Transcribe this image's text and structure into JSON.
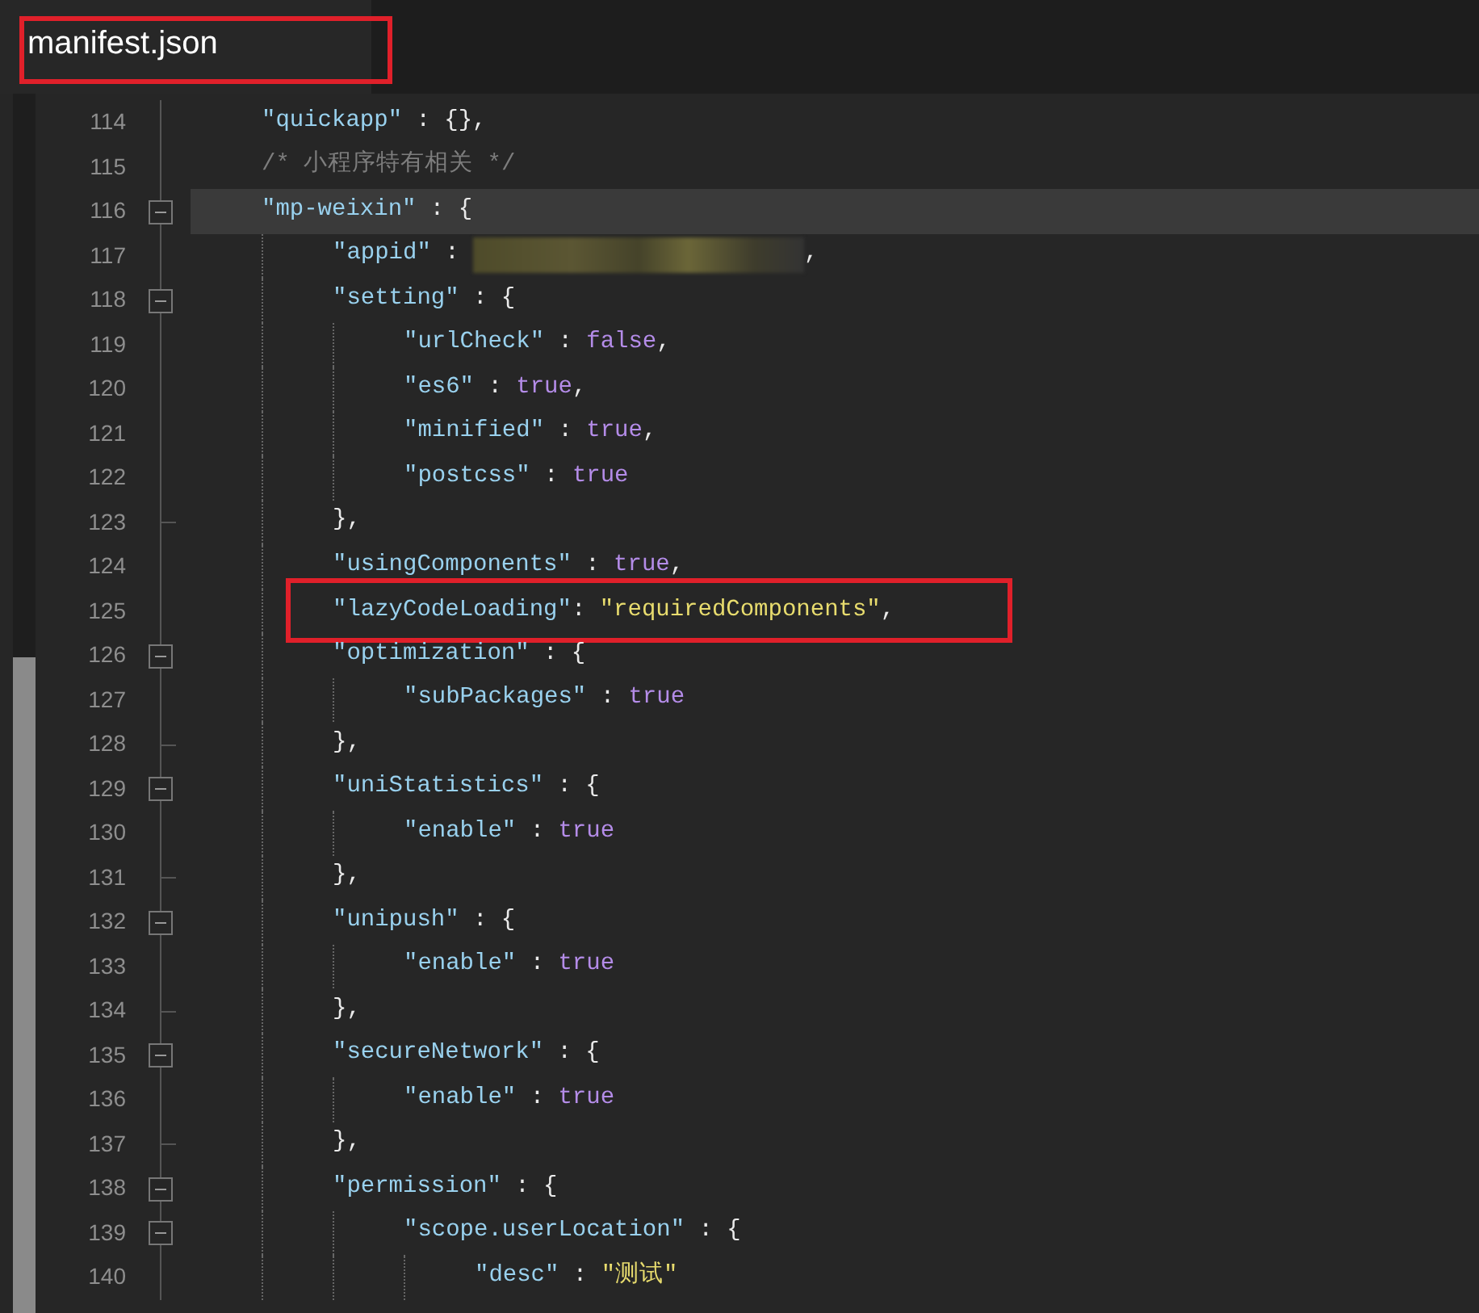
{
  "tab": {
    "title": "manifest.json",
    "highlighted": true
  },
  "lines": [
    {
      "number": "114",
      "fold_toggle": false,
      "fold_end": false,
      "current": false,
      "highlighted": false,
      "tokens": [
        {
          "t": "\"quickapp\"",
          "kind": "key"
        },
        {
          "t": " : {},",
          "kind": "punct"
        }
      ]
    },
    {
      "number": "115",
      "fold_toggle": false,
      "fold_end": false,
      "current": false,
      "highlighted": false,
      "tokens": [
        {
          "t": "/* 小程序特有相关 */",
          "kind": "comment"
        }
      ]
    },
    {
      "number": "116",
      "fold_toggle": true,
      "fold_end": false,
      "current": true,
      "highlighted": false,
      "tokens": [
        {
          "t": "\"mp-weixin\"",
          "kind": "key"
        },
        {
          "t": " : {",
          "kind": "punct"
        }
      ],
      "children": [
        {
          "number": "117",
          "fold_toggle": false,
          "fold_end": false,
          "current": false,
          "highlighted": false,
          "tokens": [
            {
              "t": "\"appid\"",
              "kind": "key"
            },
            {
              "t": " : ",
              "kind": "punct"
            },
            {
              "kind": "redacted"
            },
            {
              "t": ",",
              "kind": "punct"
            }
          ]
        },
        {
          "number": "118",
          "fold_toggle": true,
          "fold_end": false,
          "current": false,
          "highlighted": false,
          "tokens": [
            {
              "t": "\"setting\"",
              "kind": "key"
            },
            {
              "t": " : {",
              "kind": "punct"
            }
          ],
          "children": [
            {
              "number": "119",
              "fold_toggle": false,
              "fold_end": false,
              "current": false,
              "highlighted": false,
              "tokens": [
                {
                  "t": "\"urlCheck\"",
                  "kind": "key"
                },
                {
                  "t": " : ",
                  "kind": "punct"
                },
                {
                  "t": "false",
                  "kind": "bool"
                },
                {
                  "t": ",",
                  "kind": "punct"
                }
              ]
            },
            {
              "number": "120",
              "fold_toggle": false,
              "fold_end": false,
              "current": false,
              "highlighted": false,
              "tokens": [
                {
                  "t": "\"es6\"",
                  "kind": "key"
                },
                {
                  "t": " : ",
                  "kind": "punct"
                },
                {
                  "t": "true",
                  "kind": "bool"
                },
                {
                  "t": ",",
                  "kind": "punct"
                }
              ]
            },
            {
              "number": "121",
              "fold_toggle": false,
              "fold_end": false,
              "current": false,
              "highlighted": false,
              "tokens": [
                {
                  "t": "\"minified\"",
                  "kind": "key"
                },
                {
                  "t": " : ",
                  "kind": "punct"
                },
                {
                  "t": "true",
                  "kind": "bool"
                },
                {
                  "t": ",",
                  "kind": "punct"
                }
              ]
            },
            {
              "number": "122",
              "fold_toggle": false,
              "fold_end": false,
              "current": false,
              "highlighted": false,
              "tokens": [
                {
                  "t": "\"postcss\"",
                  "kind": "key"
                },
                {
                  "t": " : ",
                  "kind": "punct"
                },
                {
                  "t": "true",
                  "kind": "bool"
                }
              ]
            }
          ]
        },
        {
          "number": "123",
          "fold_toggle": false,
          "fold_end": true,
          "current": false,
          "highlighted": false,
          "tokens": [
            {
              "t": "},",
              "kind": "punct"
            }
          ]
        },
        {
          "number": "124",
          "fold_toggle": false,
          "fold_end": false,
          "current": false,
          "highlighted": false,
          "tokens": [
            {
              "t": "\"usingComponents\"",
              "kind": "key"
            },
            {
              "t": " : ",
              "kind": "punct"
            },
            {
              "t": "true",
              "kind": "bool"
            },
            {
              "t": ",",
              "kind": "punct"
            }
          ]
        },
        {
          "number": "125",
          "fold_toggle": false,
          "fold_end": false,
          "current": false,
          "highlighted": true,
          "tokens": [
            {
              "t": "\"lazyCodeLoading\"",
              "kind": "key"
            },
            {
              "t": ": ",
              "kind": "punct"
            },
            {
              "t": "\"requiredComponents\"",
              "kind": "string"
            },
            {
              "t": ",",
              "kind": "punct"
            }
          ]
        },
        {
          "number": "126",
          "fold_toggle": true,
          "fold_end": false,
          "current": false,
          "highlighted": false,
          "tokens": [
            {
              "t": "\"optimization\"",
              "kind": "key"
            },
            {
              "t": " : {",
              "kind": "punct"
            }
          ],
          "children": [
            {
              "number": "127",
              "fold_toggle": false,
              "fold_end": false,
              "current": false,
              "highlighted": false,
              "tokens": [
                {
                  "t": "\"subPackages\"",
                  "kind": "key"
                },
                {
                  "t": " : ",
                  "kind": "punct"
                },
                {
                  "t": "true",
                  "kind": "bool"
                }
              ]
            }
          ]
        },
        {
          "number": "128",
          "fold_toggle": false,
          "fold_end": true,
          "current": false,
          "highlighted": false,
          "tokens": [
            {
              "t": "},",
              "kind": "punct"
            }
          ]
        },
        {
          "number": "129",
          "fold_toggle": true,
          "fold_end": false,
          "current": false,
          "highlighted": false,
          "tokens": [
            {
              "t": "\"uniStatistics\"",
              "kind": "key"
            },
            {
              "t": " : {",
              "kind": "punct"
            }
          ],
          "children": [
            {
              "number": "130",
              "fold_toggle": false,
              "fold_end": false,
              "current": false,
              "highlighted": false,
              "tokens": [
                {
                  "t": "\"enable\"",
                  "kind": "key"
                },
                {
                  "t": " : ",
                  "kind": "punct"
                },
                {
                  "t": "true",
                  "kind": "bool"
                }
              ]
            }
          ]
        },
        {
          "number": "131",
          "fold_toggle": false,
          "fold_end": true,
          "current": false,
          "highlighted": false,
          "tokens": [
            {
              "t": "},",
              "kind": "punct"
            }
          ]
        },
        {
          "number": "132",
          "fold_toggle": true,
          "fold_end": false,
          "current": false,
          "highlighted": false,
          "tokens": [
            {
              "t": "\"unipush\"",
              "kind": "key"
            },
            {
              "t": " : {",
              "kind": "punct"
            }
          ],
          "children": [
            {
              "number": "133",
              "fold_toggle": false,
              "fold_end": false,
              "current": false,
              "highlighted": false,
              "tokens": [
                {
                  "t": "\"enable\"",
                  "kind": "key"
                },
                {
                  "t": " : ",
                  "kind": "punct"
                },
                {
                  "t": "true",
                  "kind": "bool"
                }
              ]
            }
          ]
        },
        {
          "number": "134",
          "fold_toggle": false,
          "fold_end": true,
          "current": false,
          "highlighted": false,
          "tokens": [
            {
              "t": "},",
              "kind": "punct"
            }
          ]
        },
        {
          "number": "135",
          "fold_toggle": true,
          "fold_end": false,
          "current": false,
          "highlighted": false,
          "tokens": [
            {
              "t": "\"secureNetwork\"",
              "kind": "key"
            },
            {
              "t": " : {",
              "kind": "punct"
            }
          ],
          "children": [
            {
              "number": "136",
              "fold_toggle": false,
              "fold_end": false,
              "current": false,
              "highlighted": false,
              "tokens": [
                {
                  "t": "\"enable\"",
                  "kind": "key"
                },
                {
                  "t": " : ",
                  "kind": "punct"
                },
                {
                  "t": "true",
                  "kind": "bool"
                }
              ]
            }
          ]
        },
        {
          "number": "137",
          "fold_toggle": false,
          "fold_end": true,
          "current": false,
          "highlighted": false,
          "tokens": [
            {
              "t": "},",
              "kind": "punct"
            }
          ]
        },
        {
          "number": "138",
          "fold_toggle": true,
          "fold_end": false,
          "current": false,
          "highlighted": false,
          "tokens": [
            {
              "t": "\"permission\"",
              "kind": "key"
            },
            {
              "t": " : {",
              "kind": "punct"
            }
          ],
          "children": [
            {
              "number": "139",
              "fold_toggle": true,
              "fold_end": false,
              "current": false,
              "highlighted": false,
              "tokens": [
                {
                  "t": "\"scope.userLocation\"",
                  "kind": "key"
                },
                {
                  "t": " : {",
                  "kind": "punct"
                }
              ],
              "children": [
                {
                  "number": "140",
                  "fold_toggle": false,
                  "fold_end": false,
                  "current": false,
                  "highlighted": false,
                  "tokens": [
                    {
                      "t": "\"desc\"",
                      "kind": "key"
                    },
                    {
                      "t": " : ",
                      "kind": "punct"
                    },
                    {
                      "t": "\"测试\"",
                      "kind": "string"
                    }
                  ]
                }
              ]
            }
          ]
        }
      ]
    }
  ]
}
